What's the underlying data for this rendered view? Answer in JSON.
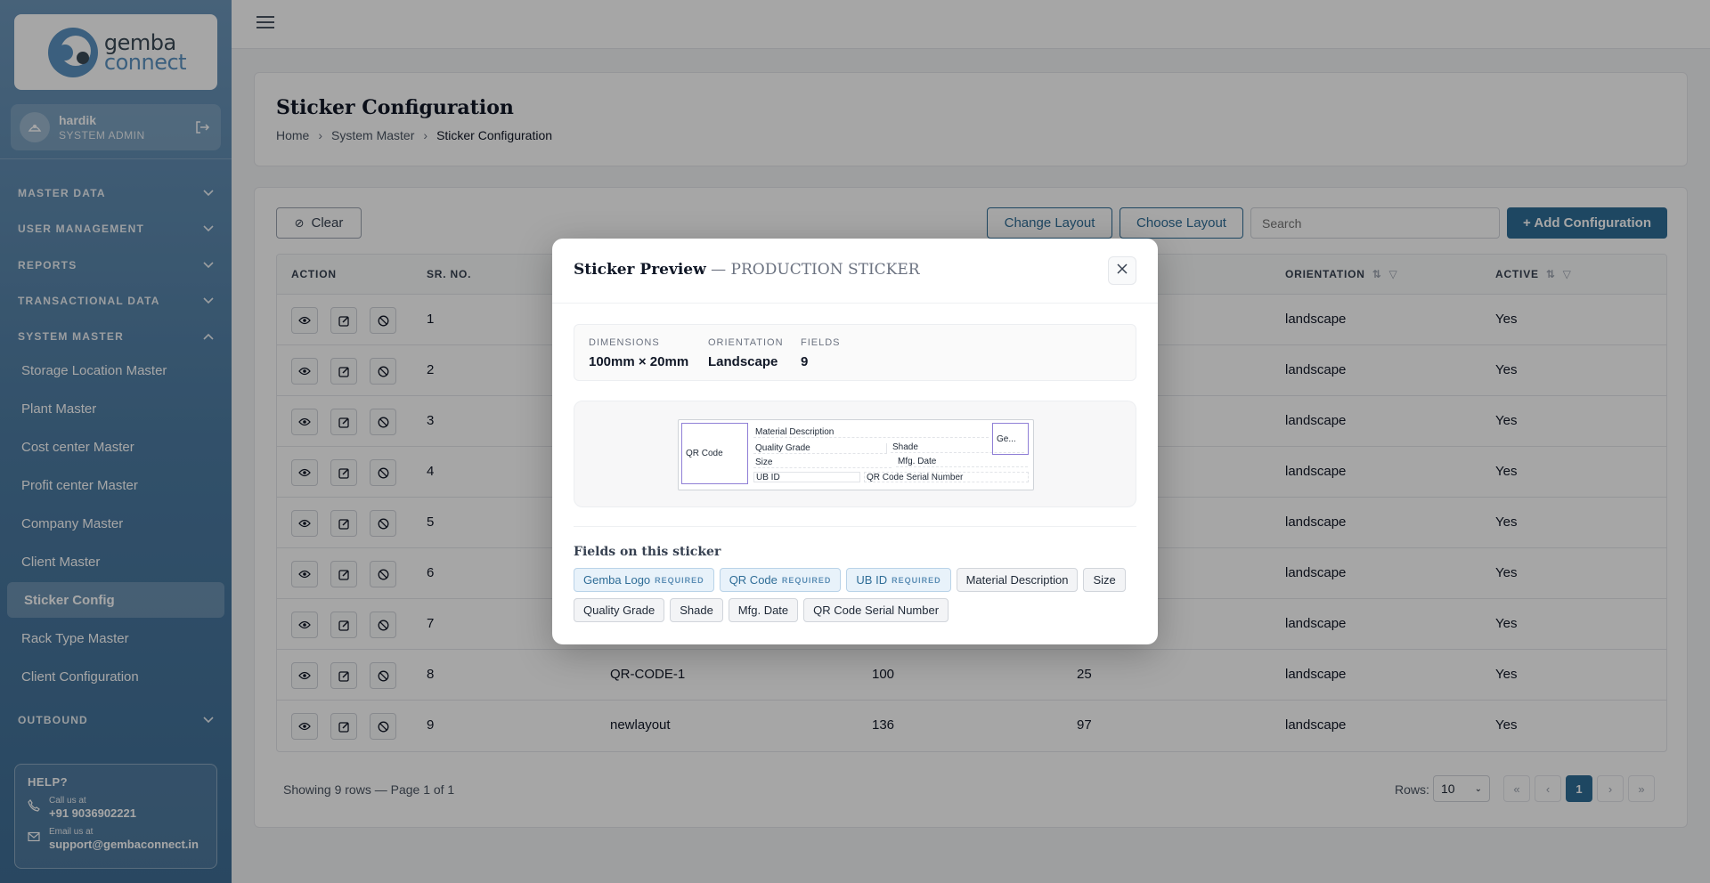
{
  "brand": {
    "line1": "gemba",
    "line2": "connect"
  },
  "user": {
    "name": "hardik",
    "role": "SYSTEM ADMIN"
  },
  "nav": {
    "sections": [
      {
        "label": "MASTER DATA",
        "expanded": false
      },
      {
        "label": "USER MANAGEMENT",
        "expanded": false
      },
      {
        "label": "REPORTS",
        "expanded": false
      },
      {
        "label": "TRANSACTIONAL DATA",
        "expanded": false
      },
      {
        "label": "SYSTEM MASTER",
        "expanded": true
      },
      {
        "label": "OUTBOUND",
        "expanded": false
      }
    ],
    "items": [
      "Storage Location Master",
      "Plant Master",
      "Cost center Master",
      "Profit center Master",
      "Company Master",
      "Client Master",
      "Sticker Config",
      "Rack Type Master",
      "Client Configuration"
    ],
    "active_item": "Sticker Config"
  },
  "help": {
    "title": "HELP?",
    "call_label": "Call us at",
    "phone": "+91 9036902221",
    "email_label": "Email us at",
    "email": "support@gembaconnect.in"
  },
  "page": {
    "title": "Sticker Configuration",
    "breadcrumb": [
      "Home",
      "System Master",
      "Sticker Configuration"
    ]
  },
  "toolbar": {
    "clear": "Clear",
    "change_layout": "Change Layout",
    "choose_layout": "Choose Layout",
    "search_placeholder": "Search",
    "add": "+ Add Configuration"
  },
  "table": {
    "headers": [
      "ACTION",
      "SR. NO.",
      "ORIENTATION",
      "ACTIVE"
    ],
    "rows": [
      {
        "sr": "1",
        "name": "",
        "w": "",
        "h": "",
        "orientation": "landscape",
        "active": "Yes"
      },
      {
        "sr": "2",
        "name": "",
        "w": "",
        "h": "",
        "orientation": "landscape",
        "active": "Yes"
      },
      {
        "sr": "3",
        "name": "",
        "w": "",
        "h": "",
        "orientation": "landscape",
        "active": "Yes"
      },
      {
        "sr": "4",
        "name": "",
        "w": "",
        "h": "",
        "orientation": "landscape",
        "active": "Yes"
      },
      {
        "sr": "5",
        "name": "",
        "w": "",
        "h": "",
        "orientation": "landscape",
        "active": "Yes"
      },
      {
        "sr": "6",
        "name": "",
        "w": "",
        "h": "",
        "orientation": "landscape",
        "active": "Yes"
      },
      {
        "sr": "7",
        "name": "",
        "w": "",
        "h": "",
        "orientation": "landscape",
        "active": "Yes"
      },
      {
        "sr": "8",
        "name": "QR-CODE-1",
        "w": "100",
        "h": "25",
        "orientation": "landscape",
        "active": "Yes"
      },
      {
        "sr": "9",
        "name": "newlayout",
        "w": "136",
        "h": "97",
        "orientation": "landscape",
        "active": "Yes"
      }
    ]
  },
  "pagination": {
    "summary": "Showing 9 rows — Page 1 of 1",
    "rows_label": "Rows:",
    "rows_value": "10",
    "current_page": "1"
  },
  "modal": {
    "title": "Sticker Preview",
    "subtitle": "— PRODUCTION STICKER",
    "dimensions_label": "DIMENSIONS",
    "dimensions": "100mm × 20mm",
    "orientation_label": "ORIENTATION",
    "orientation": "Landscape",
    "fields_label": "FIELDS",
    "fields_count": "9",
    "sticker": {
      "qr": "QR Code",
      "material": "Material Description",
      "quality": "Quality Grade",
      "shade": "Shade",
      "size": "Size",
      "mfg": "Mfg. Date",
      "ubid": "UB ID",
      "serial": "QR Code Serial Number",
      "logo": "Ge..."
    },
    "fields_title": "Fields on this sticker",
    "required_tag": "REQUIRED",
    "chips": [
      {
        "label": "Gemba Logo",
        "required": true
      },
      {
        "label": "QR Code",
        "required": true
      },
      {
        "label": "UB ID",
        "required": true
      },
      {
        "label": "Material Description",
        "required": false
      },
      {
        "label": "Size",
        "required": false
      },
      {
        "label": "Quality Grade",
        "required": false
      },
      {
        "label": "Shade",
        "required": false
      },
      {
        "label": "Mfg. Date",
        "required": false
      },
      {
        "label": "QR Code Serial Number",
        "required": false
      }
    ]
  },
  "colors": {
    "primary": "#2f6d97",
    "accent": "#8f7fd6",
    "sidebar": "#4d7ca3"
  }
}
